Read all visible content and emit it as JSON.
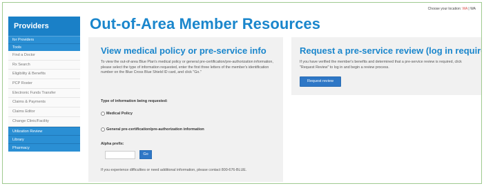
{
  "location": {
    "label": "Choose your location:",
    "value": "WA",
    "separator": "|"
  },
  "sidebar": {
    "header": "Providers",
    "items": [
      {
        "label": "for Providers",
        "style": "blue"
      },
      {
        "label": "Tools",
        "style": "blue"
      },
      {
        "label": "Find a Doctor",
        "style": "gray"
      },
      {
        "label": "Rx Search",
        "style": "gray"
      },
      {
        "label": "Eligibility & Benefits",
        "style": "gray"
      },
      {
        "label": "PCP Roster",
        "style": "gray"
      },
      {
        "label": "Electronic Funds Transfer",
        "style": "gray"
      },
      {
        "label": "Claims & Payments",
        "style": "gray"
      },
      {
        "label": "Claims Editor",
        "style": "gray"
      },
      {
        "label": "Change Clinic/Facility",
        "style": "gray"
      },
      {
        "label": "Utilization Review",
        "style": "blue"
      },
      {
        "label": "Library",
        "style": "blue"
      },
      {
        "label": "Pharmacy",
        "style": "blue"
      }
    ]
  },
  "page": {
    "title": "Out-of-Area Member Resources"
  },
  "policy_panel": {
    "title": "View medical policy or pre-service info",
    "intro": "To view the out-of-area Blue Plan's medical policy or general pre-certification/pre-authorization information, please select the type of information requested, enter the first three letters of the member's identification number on the Blue Cross Blue Shield ID card, and click \"Go.\"",
    "type_label": "Type of information being requested:",
    "option_medical": "Medical Policy",
    "option_precert": "General pre-certification/pre-authorization information",
    "alpha_label": "Alpha prefix:",
    "alpha_value": "",
    "go_label": "Go",
    "help_text": "If you experience difficulties or need additional information, please contact 800-676-BLUE."
  },
  "review_panel": {
    "title": "Request a pre-service review (log in required)",
    "intro": "If you have verified the member's benefits and determined that a pre-service review is required, click \"Request Review\" to log in and begin a review process.",
    "button_label": "Request review"
  },
  "colors": {
    "accent": "#1a86cc",
    "sidebar_header": "#1a80c7",
    "sidebar_blue": "#2a8fd4",
    "button": "#2e77c6",
    "panel_bg": "#f1f1f1",
    "frame_border": "#9fc98f"
  }
}
